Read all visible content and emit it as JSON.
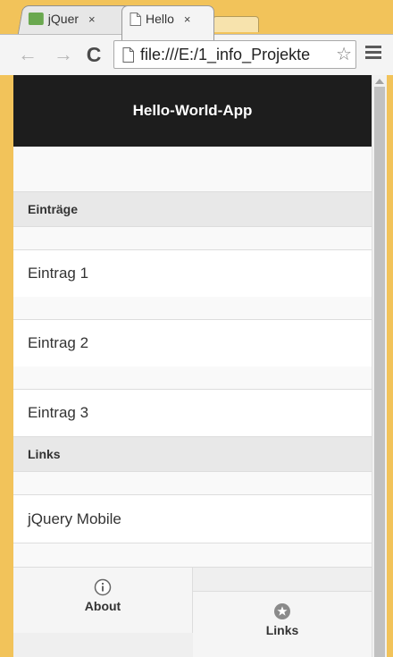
{
  "browser": {
    "tabs": [
      {
        "title": "jQuer",
        "close": "×"
      },
      {
        "title": "Hello",
        "close": "×"
      }
    ],
    "address": "file:///E:/1_info_Projekte",
    "star": "☆",
    "nav": {
      "back": "←",
      "forward": "→",
      "reload": "C"
    }
  },
  "app": {
    "header_title": "Hello-World-App",
    "sections": [
      {
        "title": "Einträge",
        "items": [
          "Eintrag 1",
          "Eintrag 2",
          "Eintrag 3"
        ]
      },
      {
        "title": "Links",
        "items": [
          "jQuery Mobile"
        ]
      }
    ],
    "footer": {
      "about_label": "About",
      "links_label": "Links"
    }
  },
  "icons": {
    "info": "info-icon",
    "star": "star-icon"
  },
  "colors": {
    "header_bg": "#1d1d1d",
    "divider_bg": "#e8e8e8",
    "browser_frame": "#f2c35a"
  }
}
